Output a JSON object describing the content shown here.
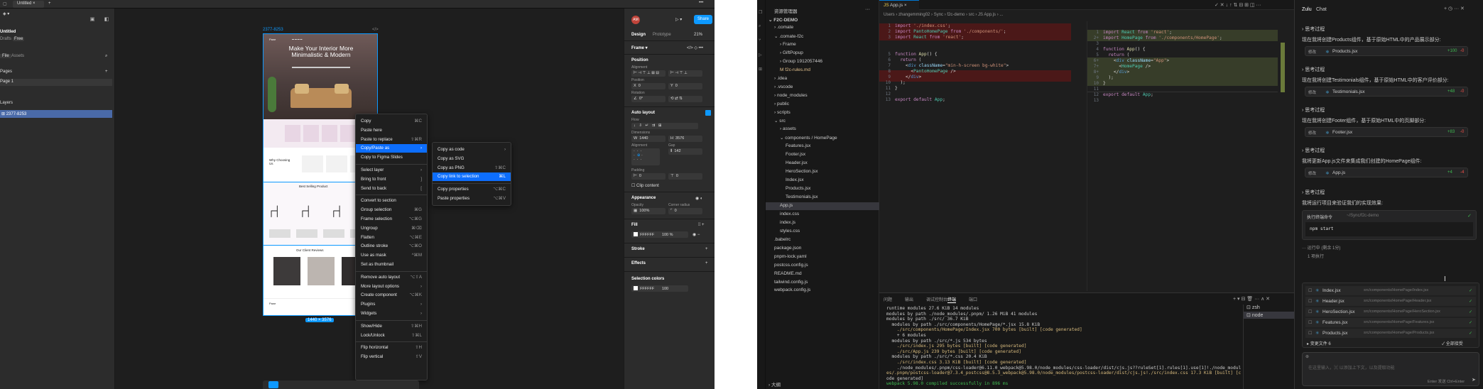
{
  "figma": {
    "tab_title": "Untitled",
    "file_title": "Untitled",
    "drafts": "Drafts",
    "free_badge": "Free",
    "left_tabs": [
      "File",
      "Assets"
    ],
    "pages_label": "Pages",
    "page1": "Page 1",
    "layers_label": "Layers",
    "layer1": "2377-8253",
    "frame_label": "2377-8253",
    "frame_size_badge": "1440 × 3576",
    "right_tabs": [
      "Design",
      "Prototype"
    ],
    "zoom": "21%",
    "share": "Share",
    "avatar": "AM",
    "frame_type": "Frame",
    "position": "Position",
    "alignment": "Alignment",
    "position_label": "Position",
    "x": "0",
    "y": "0",
    "rotation_label": "Rotation",
    "rotation": "0°",
    "auto_layout": "Auto layout",
    "flow": "Flow",
    "dimensions": "Dimensions",
    "w": "1440",
    "h": "3576",
    "alignment2": "Alignment",
    "gap": "Gap",
    "gap_value": "142",
    "padding": "Padding",
    "pad_x": "0",
    "pad_y": "0",
    "clip": "Clip content",
    "appearance": "Appearance",
    "opacity_label": "Opacity",
    "corner_label": "Corner radius",
    "opacity": "100%",
    "corner": "0",
    "fill": "Fill",
    "fill_hex": "FFFFFF",
    "fill_pct": "100",
    "fill_pct_unit": "%",
    "stroke": "Stroke",
    "effects": "Effects",
    "sel_colors": "Selection colors",
    "sel_hex": "FFFFFF",
    "sel_pct": "100"
  },
  "mock": {
    "logo": "Pane",
    "hero_title": "Make Your Interior More Minimalistic & Modern",
    "why": "Why Choosing Us",
    "best_selling": "Best Selling Product",
    "reviews": "Our Client Reviews",
    "footer_logo": "Pane"
  },
  "context_menu": [
    {
      "label": "Copy",
      "sc": "⌘C"
    },
    {
      "label": "Paste here",
      "sc": ""
    },
    {
      "label": "Paste to replace",
      "sc": "⇧⌘R"
    },
    {
      "label": "Copy/Paste as",
      "sc": "›",
      "hl": true
    },
    {
      "label": "Copy to Figma Slides",
      "sc": ""
    },
    {
      "sep": true
    },
    {
      "label": "Select layer",
      "sc": "›"
    },
    {
      "label": "Bring to front",
      "sc": "]"
    },
    {
      "label": "Send to back",
      "sc": "["
    },
    {
      "sep": true
    },
    {
      "label": "Convert to section",
      "sc": ""
    },
    {
      "label": "Group selection",
      "sc": "⌘G"
    },
    {
      "label": "Frame selection",
      "sc": "⌥⌘G"
    },
    {
      "label": "Ungroup",
      "sc": "⌘⌫"
    },
    {
      "label": "Flatten",
      "sc": "⌥⌘E"
    },
    {
      "label": "Outline stroke",
      "sc": "⌥⌘O"
    },
    {
      "label": "Use as mask",
      "sc": "^⌘M"
    },
    {
      "label": "Set as thumbnail",
      "sc": ""
    },
    {
      "sep": true
    },
    {
      "label": "Remove auto layout",
      "sc": "⌥⇧A"
    },
    {
      "label": "More layout options",
      "sc": "›"
    },
    {
      "label": "Create component",
      "sc": "⌥⌘K"
    },
    {
      "label": "Plugins",
      "sc": "›"
    },
    {
      "label": "Widgets",
      "sc": "›"
    },
    {
      "sep": true
    },
    {
      "label": "Show/Hide",
      "sc": "⇧⌘H"
    },
    {
      "label": "Lock/Unlock",
      "sc": "⇧⌘L"
    },
    {
      "sep": true
    },
    {
      "label": "Flip horizontal",
      "sc": "⇧H"
    },
    {
      "label": "Flip vertical",
      "sc": "⇧V"
    }
  ],
  "submenu": [
    {
      "label": "Copy as code",
      "sc": "›"
    },
    {
      "label": "Copy as SVG",
      "sc": ""
    },
    {
      "label": "Copy as PNG",
      "sc": "⇧⌘C"
    },
    {
      "label": "Copy link to selection",
      "sc": "⌘L",
      "hl": true
    },
    {
      "sep": true
    },
    {
      "label": "Copy properties",
      "sc": "⌥⌘C"
    },
    {
      "label": "Paste properties",
      "sc": "⌥⌘V"
    }
  ],
  "vscode": {
    "explorer_title": "资源管理器",
    "project": "F2C-DEMO",
    "tree": [
      {
        "t": "› .comate",
        "d": 1
      },
      {
        "t": "⌄ .comate-f2c",
        "d": 1
      },
      {
        "t": "› Frame",
        "d": 2
      },
      {
        "t": "› GiftPopup",
        "d": 2
      },
      {
        "t": "› Group 1912057446",
        "d": 2
      },
      {
        "t": "M f2c-rules.md",
        "d": 2
      },
      {
        "t": "› .idea",
        "d": 1
      },
      {
        "t": "› .vscode",
        "d": 1
      },
      {
        "t": "› node_modules",
        "d": 1
      },
      {
        "t": "› public",
        "d": 1
      },
      {
        "t": "› scripts",
        "d": 1
      },
      {
        "t": "⌄ src",
        "d": 1
      },
      {
        "t": "› assets",
        "d": 2
      },
      {
        "t": "⌄ components / HomePage",
        "d": 2
      },
      {
        "t": "Features.jsx",
        "d": 3
      },
      {
        "t": "Footer.jsx",
        "d": 3
      },
      {
        "t": "Header.jsx",
        "d": 3
      },
      {
        "t": "HeroSection.jsx",
        "d": 3
      },
      {
        "t": "Index.jsx",
        "d": 3
      },
      {
        "t": "Products.jsx",
        "d": 3
      },
      {
        "t": "Testimonials.jsx",
        "d": 3
      },
      {
        "t": "App.js",
        "d": 2,
        "sel": true
      },
      {
        "t": "index.css",
        "d": 2
      },
      {
        "t": "index.js",
        "d": 2
      },
      {
        "t": "styles.css",
        "d": 2
      },
      {
        "t": ".babelrc",
        "d": 1
      },
      {
        "t": "package.json",
        "d": 1
      },
      {
        "t": "pnpm-lock.yaml",
        "d": 1
      },
      {
        "t": "postcss.config.js",
        "d": 1
      },
      {
        "t": "README.md",
        "d": 1
      },
      {
        "t": "tailwind.config.js",
        "d": 1
      },
      {
        "t": "webpack.config.js",
        "d": 1
      }
    ],
    "outline": "大纲",
    "tab": "App.js",
    "breadcrumb": "Users › zhangemming02 › Sync › f2c-demo › src › JS App.js › ...",
    "term_tabs": [
      "问题",
      "输出",
      "调试控制台",
      "终端",
      "端口"
    ],
    "term_lines": [
      "runtime modules 27.6 KiB 14 modules",
      "modules by path ./node_modules/.pnpm/ 1.26 MiB 41 modules",
      "modules by path ./src/ 36.7 KiB",
      "  modules by path ./src/components/HomePage/*.jsx 15.8 KiB",
      "    ./src/components/HomePage/Index.jsx 700 bytes [built] [code generated]",
      "    + 6 modules",
      "  modules by path ./src/*.js 534 bytes",
      "    ./src/index.js 295 bytes [built] [code generated]",
      "    ./src/App.js 239 bytes [built] [code generated]",
      "  modules by path ./src/*.css 20.4 KiB",
      "    ./src/index.css 3.13 KiB [built] [code generated]",
      "    ./node_modules/.pnpm/css-loader@6.11.0_webpack@5.98.0/node_modules/css-loader/dist/cjs.js??ruleSet[1].rules[1].use[1]!./node_modul",
      "es/.pnpm/postcss-loader@7.3.4_postcss@8.5.3_webpack@5.98.0/node_modules/postcss-loader/dist/cjs.js!./src/index.css 17.3 KiB [built] [c",
      "ode generated]",
      "webpack 5.98.0 compiled successfully in 896 ms"
    ],
    "shells": [
      "zsh",
      "node"
    ]
  },
  "chat": {
    "tabs": [
      "Zulu",
      "Chat"
    ],
    "items": [
      {
        "think": "思考过程",
        "desc": "现在我将创建Products组件，基于原始HTML中的产品展示部分:",
        "file": "Products.jsx",
        "plus": "+100",
        "minus": "-0"
      },
      {
        "think": "思考过程",
        "desc": "现在我将创建Testimonials组件，基于原始HTML中的客户评价部分:",
        "file": "Testimonials.jsx",
        "plus": "+48",
        "minus": "-0"
      },
      {
        "think": "思考过程",
        "desc": "现在我将创建Footer组件，基于原始HTML中的页脚部分:",
        "file": "Footer.jsx",
        "plus": "+83",
        "minus": "-0"
      },
      {
        "think": "思考过程",
        "desc": "我将更新App.js文件来集成我们创建的HomePage组件:",
        "file": "App.js",
        "plus": "+4",
        "minus": "-4"
      }
    ],
    "think5": "思考过程",
    "run_desc": "我将运行项目来验证我们的实现效果:",
    "run_label": "执行终端命令",
    "run_path": "~/Sync/f2c-demo",
    "command": "npm start",
    "wait": "运行中 (剩余 1分)",
    "step": "1 项执行",
    "changes": [
      {
        "file": "Index.jsx",
        "path": "src/components/HomePage/Index.jsx"
      },
      {
        "file": "Header.jsx",
        "path": "src/components/HomePage/Header.jsx"
      },
      {
        "file": "HeroSection.jsx",
        "path": "src/components/HomePage/HeroSection.jsx"
      },
      {
        "file": "Features.jsx",
        "path": "src/components/HomePage/Features.jsx"
      },
      {
        "file": "Products.jsx",
        "path": "src/components/HomePage/Products.jsx"
      }
    ],
    "changes_count": "变更文件 6",
    "accept_all": "全部接受",
    "input_placeholder": "在这里输入，⌘ 以添加上下文，以及提取功能",
    "send_hint": "Enter 发送 Ctrl+Enter"
  }
}
